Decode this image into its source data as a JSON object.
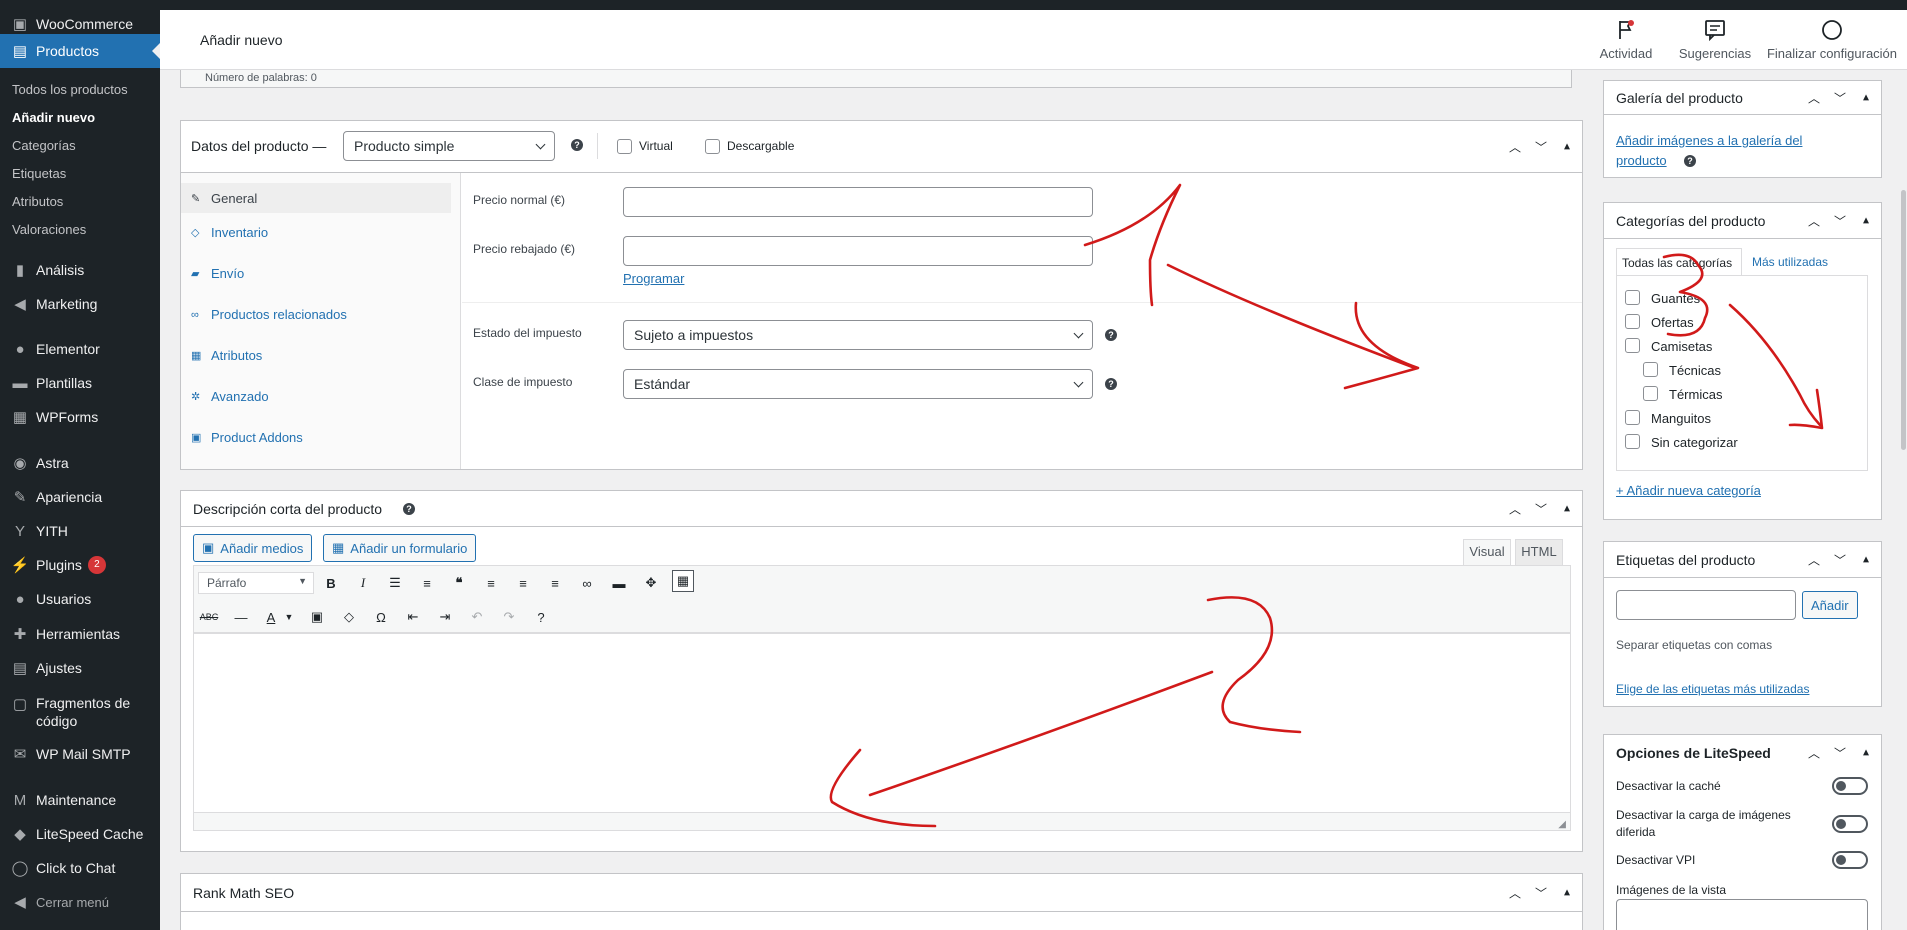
{
  "sidebar": {
    "items": [
      {
        "label": "WooCommerce",
        "icon": "woocommerce-icon"
      },
      {
        "label": "Productos",
        "icon": "archive-icon"
      },
      {
        "label": "Análisis",
        "icon": "bar-chart-icon"
      },
      {
        "label": "Marketing",
        "icon": "megaphone-icon"
      },
      {
        "label": "Elementor",
        "icon": "elementor-icon"
      },
      {
        "label": "Plantillas",
        "icon": "folder-icon"
      },
      {
        "label": "WPForms",
        "icon": "form-icon"
      },
      {
        "label": "Astra",
        "icon": "astra-icon"
      },
      {
        "label": "Apariencia",
        "icon": "brush-icon"
      },
      {
        "label": "YITH",
        "icon": "yith-icon"
      },
      {
        "label": "Plugins",
        "icon": "plugin-icon",
        "badge": "2"
      },
      {
        "label": "Usuarios",
        "icon": "user-icon"
      },
      {
        "label": "Herramientas",
        "icon": "wrench-icon"
      },
      {
        "label": "Ajustes",
        "icon": "settings-icon"
      },
      {
        "label": "Fragmentos de código",
        "icon": "code-icon"
      },
      {
        "label": "WP Mail SMTP",
        "icon": "mail-icon"
      },
      {
        "label": "Maintenance",
        "icon": "maintenance-icon"
      },
      {
        "label": "LiteSpeed Cache",
        "icon": "litespeed-icon"
      },
      {
        "label": "Click to Chat",
        "icon": "whatsapp-icon"
      },
      {
        "label": "Cerrar menú",
        "icon": "collapse-icon"
      }
    ],
    "submenu": [
      "Todos los productos",
      "Añadir nuevo",
      "Categorías",
      "Etiquetas",
      "Atributos",
      "Valoraciones"
    ]
  },
  "header": {
    "title": "Añadir nuevo",
    "actions": [
      "Actividad",
      "Sugerencias",
      "Finalizar configuración"
    ]
  },
  "word_count": "Número de palabras: 0",
  "product_data": {
    "title": "Datos del producto —",
    "type": "Producto simple",
    "virtual": "Virtual",
    "downloadable": "Descargable",
    "tabs": [
      "General",
      "Inventario",
      "Envío",
      "Productos relacionados",
      "Atributos",
      "Avanzado",
      "Product Addons"
    ],
    "regular_price_label": "Precio normal (€)",
    "sale_price_label": "Precio rebajado (€)",
    "schedule": "Programar",
    "tax_status_label": "Estado del impuesto",
    "tax_status": "Sujeto a impuestos",
    "tax_class_label": "Clase de impuesto",
    "tax_class": "Estándar"
  },
  "short_description": {
    "title": "Descripción corta del producto",
    "add_media": "Añadir medios",
    "add_form": "Añadir un formulario",
    "tab_visual": "Visual",
    "tab_html": "HTML",
    "format": "Párrafo"
  },
  "rank_math": {
    "title": "Rank Math SEO"
  },
  "gallery": {
    "title": "Galería del producto",
    "add_link": "Añadir imágenes a la galería del producto"
  },
  "categories": {
    "title": "Categorías del producto",
    "tab_all": "Todas las categorías",
    "tab_used": "Más utilizadas",
    "items": [
      {
        "label": "Guantes",
        "child": false
      },
      {
        "label": "Ofertas",
        "child": false
      },
      {
        "label": "Camisetas",
        "child": false
      },
      {
        "label": "Técnicas",
        "child": true
      },
      {
        "label": "Térmicas",
        "child": true
      },
      {
        "label": "Manguitos",
        "child": false
      },
      {
        "label": "Sin categorizar",
        "child": false
      }
    ],
    "add_new": "+ Añadir nueva categoría"
  },
  "tags": {
    "title": "Etiquetas del producto",
    "add_button": "Añadir",
    "hint": "Separar etiquetas con comas",
    "choose_link": "Elige de las etiquetas más utilizadas"
  },
  "litespeed": {
    "title": "Opciones de LiteSpeed",
    "options": [
      "Desactivar la caché",
      "Desactivar la carga de imágenes diferida",
      "Desactivar VPI"
    ],
    "viewport_label": "Imágenes de la vista"
  },
  "colors": {
    "accent": "#2271b1",
    "sidebar": "#1d2327",
    "annotation": "#d11a1a"
  }
}
